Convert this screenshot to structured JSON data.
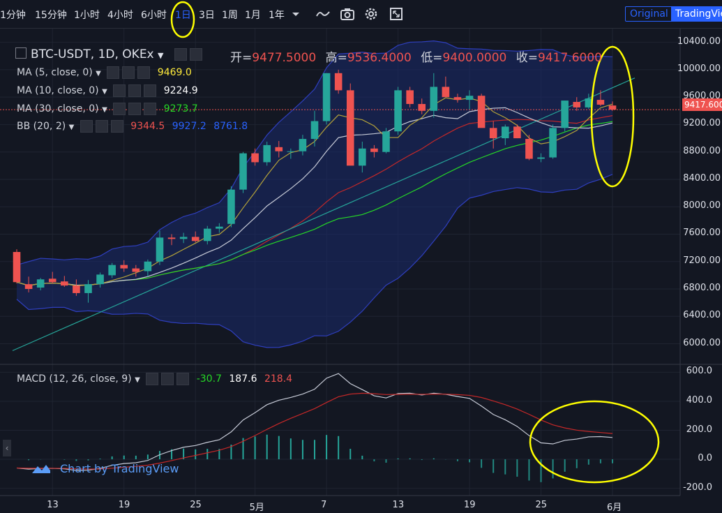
{
  "toolbar": {
    "timeframes": [
      {
        "label": "1分钟",
        "active": false
      },
      {
        "label": "15分钟",
        "active": false
      },
      {
        "label": "1小时",
        "active": false
      },
      {
        "label": "4小时",
        "active": false
      },
      {
        "label": "6小时",
        "active": false
      },
      {
        "label": "1日",
        "active": true
      },
      {
        "label": "3日",
        "active": false
      },
      {
        "label": "1周",
        "active": false
      },
      {
        "label": "1月",
        "active": false
      },
      {
        "label": "1年",
        "active": false
      }
    ],
    "original_label": "Original",
    "tradingview_label": "TradingView",
    "icons": [
      "dropdown-icon",
      "line-style-icon",
      "camera-icon",
      "settings-icon",
      "fullscreen-icon"
    ]
  },
  "symbol": {
    "name": "BTC-USDT, 1D, OKEx"
  },
  "ohlc": {
    "open_label": "开=",
    "open": "9477.5000",
    "high_label": "高=",
    "high": "9536.4000",
    "low_label": "低=",
    "low": "9400.0000",
    "close_label": "收=",
    "close": "9417.6000"
  },
  "indicators": {
    "ma5": {
      "label": "MA (5, close, 0)",
      "value": "9469.0",
      "color": "#ffeb3b"
    },
    "ma10": {
      "label": "MA (10, close, 0)",
      "value": "9224.9",
      "color": "#ffffff"
    },
    "ma30": {
      "label": "MA (30, close, 0)",
      "value": "9273.7",
      "color": "#26d926"
    },
    "bb": {
      "label": "BB (20, 2)",
      "v1": "9344.5",
      "v2": "9927.2",
      "v3": "8761.8",
      "c1": "#ef5350",
      "c2": "#2962ff",
      "c3": "#2962ff"
    },
    "macd": {
      "label": "MACD (12, 26, close, 9)",
      "hist": "-30.7",
      "macd": "187.6",
      "signal": "218.4"
    }
  },
  "price_tag": "9417.600",
  "price_axis": [
    "10400.00",
    "10000.00",
    "9600.00",
    "9200.00",
    "8800.00",
    "8400.00",
    "8000.00",
    "7600.00",
    "7200.00",
    "6800.00",
    "6400.00",
    "6000.00"
  ],
  "macd_axis": [
    "600.0",
    "400.0",
    "200.0",
    "0.0",
    "-200.0"
  ],
  "time_axis": [
    "13",
    "19",
    "25",
    "5月",
    "7",
    "13",
    "19",
    "25",
    "6月"
  ],
  "watermark": "Chart by TradingView",
  "annotations": {
    "circle_color": "#ffff00"
  },
  "colors": {
    "up": "#26a69a",
    "down": "#ef5350",
    "bg": "#131722",
    "active": "#2962ff"
  },
  "chart_data": {
    "type": "candlestick",
    "title": "BTC-USDT, 1D, OKEx",
    "ohlc": [
      [
        7340,
        7380,
        6880,
        6900
      ],
      [
        6870,
        6980,
        6750,
        6800
      ],
      [
        6820,
        6960,
        6780,
        6940
      ],
      [
        6950,
        7050,
        6880,
        6900
      ],
      [
        6910,
        6990,
        6830,
        6850
      ],
      [
        6850,
        6940,
        6700,
        6740
      ],
      [
        6740,
        6930,
        6600,
        6870
      ],
      [
        6870,
        7040,
        6820,
        7010
      ],
      [
        7000,
        7180,
        6960,
        7150
      ],
      [
        7150,
        7220,
        7050,
        7100
      ],
      [
        7100,
        7150,
        6980,
        7050
      ],
      [
        7060,
        7230,
        6980,
        7200
      ],
      [
        7200,
        7650,
        7150,
        7550
      ],
      [
        7550,
        7600,
        7440,
        7530
      ],
      [
        7530,
        7620,
        7470,
        7560
      ],
      [
        7560,
        7640,
        7480,
        7500
      ],
      [
        7500,
        7720,
        7450,
        7680
      ],
      [
        7680,
        7760,
        7620,
        7710
      ],
      [
        7750,
        8300,
        7700,
        8250
      ],
      [
        8250,
        8800,
        8200,
        8780
      ],
      [
        8780,
        8850,
        8600,
        8650
      ],
      [
        8650,
        8950,
        8600,
        8900
      ],
      [
        8870,
        8960,
        8720,
        8810
      ],
      [
        8800,
        8850,
        8700,
        8810
      ],
      [
        8810,
        9050,
        8750,
        8990
      ],
      [
        8990,
        9400,
        8880,
        9250
      ],
      [
        9250,
        9950,
        9200,
        9950
      ],
      [
        9950,
        10000,
        9650,
        9700
      ],
      [
        9700,
        9800,
        8700,
        8600
      ],
      [
        8600,
        8950,
        8500,
        8850
      ],
      [
        8850,
        8900,
        8720,
        8800
      ],
      [
        8800,
        9150,
        8780,
        9100
      ],
      [
        9100,
        9750,
        9050,
        9700
      ],
      [
        9700,
        9750,
        9450,
        9500
      ],
      [
        9500,
        9580,
        9350,
        9400
      ],
      [
        9400,
        9950,
        9300,
        9750
      ],
      [
        9750,
        9900,
        9600,
        9600
      ],
      [
        9600,
        9650,
        9520,
        9560
      ],
      [
        9560,
        9700,
        9420,
        9620
      ],
      [
        9620,
        9650,
        9200,
        9150
      ],
      [
        9150,
        9250,
        8850,
        9000
      ],
      [
        9000,
        9200,
        8900,
        9170
      ],
      [
        9170,
        9200,
        9000,
        9000
      ],
      [
        8990,
        9050,
        8680,
        8700
      ],
      [
        8700,
        8780,
        8650,
        8720
      ],
      [
        8720,
        9200,
        8700,
        9150
      ],
      [
        9150,
        9550,
        9100,
        9550
      ],
      [
        9530,
        9600,
        9400,
        9450
      ],
      [
        9450,
        9650,
        9430,
        9580
      ],
      [
        9560,
        9700,
        9470,
        9490
      ],
      [
        9477.5,
        9536.4,
        9400,
        9417.6
      ]
    ],
    "ylim": [
      5700,
      10600
    ],
    "macd_ylim": [
      -250,
      650
    ]
  }
}
